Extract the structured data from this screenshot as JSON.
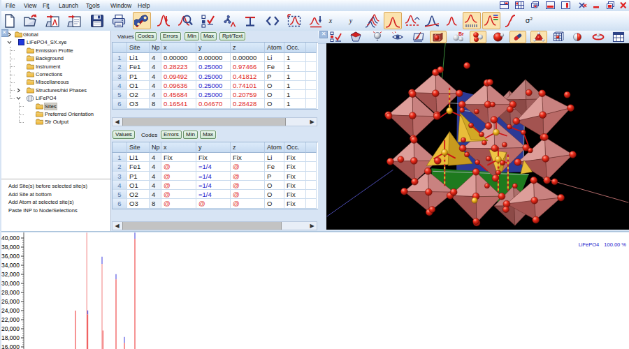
{
  "app": {
    "name": "TOPAS"
  },
  "menu": {
    "items": [
      {
        "label": "File"
      },
      {
        "label": "View"
      },
      {
        "label": "Fit",
        "underline": 2
      },
      {
        "label": "Launch"
      },
      {
        "label": "Tools",
        "underline": 1
      },
      {
        "label": "Window"
      },
      {
        "label": "Help"
      }
    ]
  },
  "window_controls": [
    "tile-panes",
    "arrange-grid",
    "cascade-windows",
    "tile-horizontal",
    "tile-vertical",
    "close-all",
    "minimize",
    "restore",
    "close"
  ],
  "toolbar": {
    "buttons": [
      "new-file",
      "open-file",
      "import-data",
      "open-copy",
      "save",
      "print",
      "fit-wrench",
      "quick-fit",
      "zoom-peak",
      "parameter-list",
      "launch-kernel",
      "tolerance",
      "show-inp-code",
      "select-region",
      "peak-shift",
      "x-axis",
      "y-axis",
      "stack-scans",
      "single-scan",
      "difference-plot",
      "background-plot",
      "calc-pattern",
      "hkl-ticks",
      "legend-display",
      "cumulative-chi2",
      "sigma-squared"
    ],
    "highlighted": [
      "fit-wrench",
      "single-scan",
      "hkl-ticks",
      "legend-display"
    ],
    "x_label": "x",
    "y_label": "y",
    "sigma_label": "σ²"
  },
  "tree": {
    "close_label": "x",
    "items": [
      {
        "label": "Global",
        "depth": 0,
        "icon": "folder",
        "arrow": "collapsed"
      },
      {
        "label": "LiFePO4_SX.xye",
        "depth": 0,
        "icon": "file",
        "arrow": "expanded"
      },
      {
        "label": "Emission Profile",
        "depth": 1,
        "icon": "folder"
      },
      {
        "label": "Background",
        "depth": 1,
        "icon": "folder"
      },
      {
        "label": "Instrument",
        "depth": 1,
        "icon": "folder"
      },
      {
        "label": "Corrections",
        "depth": 1,
        "icon": "folder"
      },
      {
        "label": "Miscellaneous",
        "depth": 1,
        "icon": "folder"
      },
      {
        "label": "Structures/hkl Phases",
        "depth": 1,
        "icon": "folder",
        "arrow": "collapsed"
      },
      {
        "label": "LiFePO4",
        "depth": 1,
        "icon": "phase",
        "arrow": "expanded"
      },
      {
        "label": "Sites",
        "depth": 2,
        "icon": "folder",
        "selected": true
      },
      {
        "label": "Preferred Orientation",
        "depth": 2,
        "icon": "folder"
      },
      {
        "label": "Str Output",
        "depth": 2,
        "icon": "folder"
      }
    ]
  },
  "actions": [
    "Add Site(s) before selected site(s)",
    "Add Site at bottom",
    "Add Atom at selected site(s)",
    "Paste INP to Node/Selections"
  ],
  "tables": [
    {
      "tabs": [
        "Values",
        "Codes",
        "Errors",
        "Min",
        "Max",
        "Rpt/Text"
      ],
      "active_tab": "Values",
      "columns": [
        "",
        "Site",
        "Np",
        "x",
        "y",
        "z",
        "Atom",
        "Occ.",
        ""
      ],
      "rows": [
        [
          "1",
          "Li1",
          "4",
          [
            "0.00000",
            "k"
          ],
          [
            "0.00000",
            "k"
          ],
          [
            "0.00000",
            "k"
          ],
          "Li",
          "1"
        ],
        [
          "2",
          "Fe1",
          "4",
          [
            "0.28223",
            "red"
          ],
          [
            "0.25000",
            "blue"
          ],
          [
            "0.97466",
            "red"
          ],
          "Fe",
          "1"
        ],
        [
          "3",
          "P1",
          "4",
          [
            "0.09492",
            "red"
          ],
          [
            "0.25000",
            "blue"
          ],
          [
            "0.41812",
            "red"
          ],
          "P",
          "1"
        ],
        [
          "4",
          "O1",
          "4",
          [
            "0.09636",
            "red"
          ],
          [
            "0.25000",
            "blue"
          ],
          [
            "0.74101",
            "red"
          ],
          "O",
          "1"
        ],
        [
          "5",
          "O2",
          "4",
          [
            "0.45684",
            "red"
          ],
          [
            "0.25000",
            "blue"
          ],
          [
            "0.20759",
            "red"
          ],
          "O",
          "1"
        ],
        [
          "6",
          "O3",
          "8",
          [
            "0.16541",
            "red"
          ],
          [
            "0.04670",
            "red"
          ],
          [
            "0.28428",
            "red"
          ],
          "O",
          "1"
        ]
      ]
    },
    {
      "tabs": [
        "Values",
        "Codes",
        "Errors",
        "Min",
        "Max"
      ],
      "active_tab": "Codes",
      "columns": [
        "",
        "Site",
        "Np",
        "x",
        "y",
        "z",
        "Atom",
        "Occ.",
        ""
      ],
      "rows": [
        [
          "1",
          "Li1",
          "4",
          [
            "Fix",
            "k"
          ],
          [
            "Fix",
            "k"
          ],
          [
            "Fix",
            "k"
          ],
          "Li",
          "Fix"
        ],
        [
          "2",
          "Fe1",
          "4",
          [
            "@",
            "red"
          ],
          [
            "=1/4",
            "blue"
          ],
          [
            "@",
            "red"
          ],
          "Fe",
          "Fix"
        ],
        [
          "3",
          "P1",
          "4",
          [
            "@",
            "red"
          ],
          [
            "=1/4",
            "blue"
          ],
          [
            "@",
            "red"
          ],
          "P",
          "Fix"
        ],
        [
          "4",
          "O1",
          "4",
          [
            "@",
            "red"
          ],
          [
            "=1/4",
            "blue"
          ],
          [
            "@",
            "red"
          ],
          "O",
          "Fix"
        ],
        [
          "5",
          "O2",
          "4",
          [
            "@",
            "red"
          ],
          [
            "=1/4",
            "blue"
          ],
          [
            "@",
            "red"
          ],
          "O",
          "Fix"
        ],
        [
          "6",
          "O3",
          "8",
          [
            "@",
            "red"
          ],
          [
            "@",
            "red"
          ],
          [
            "@",
            "red"
          ],
          "O",
          "Fix"
        ]
      ]
    }
  ],
  "structure_viewer": {
    "toolbar": [
      "close-pane",
      "site-list",
      "polyhedra-style",
      "balloon-style",
      "view-options",
      "edit-structure",
      "unit-cell-box",
      "element-labels",
      "spheres-display",
      "spacefill-style",
      "stick-style",
      "polyhedra-display",
      "cell-grid",
      "occupancy-display",
      "bond-style",
      "properties-table"
    ],
    "toolbar_highlighted": [
      "unit-cell-box",
      "spheres-display",
      "stick-style",
      "polyhedra-display"
    ],
    "phase": "LiFePO4",
    "colors": {
      "octahedra": "#c98280",
      "tetrahedra": "#e9bd3a",
      "oxygen": "#e02215",
      "phosphorus": "#f0b820",
      "cell_plane_bc": "#2c3a96",
      "cell_plane_ab": "#1e7a1e",
      "axis_a": "#b06868",
      "axis_b": "#3a8a3a",
      "axis_c": "#4a4aa8",
      "background": "#000000"
    }
  },
  "chart_data": {
    "type": "bar",
    "title": "",
    "xlabel": "",
    "ylabel": "",
    "grid": false,
    "legend_position": "top-right",
    "legend": {
      "phase": "LiFePO4",
      "percent": "100.00 %"
    },
    "series": [
      {
        "name": "observed",
        "color": "#4a4ae0"
      },
      {
        "name": "calculated",
        "color": "#ee3b3b"
      },
      {
        "name": "calculated-faint",
        "color": "#f28a8a"
      }
    ],
    "y_axis": {
      "ticks": [
        "40,000",
        "38,000",
        "36,000",
        "34,000",
        "32,000",
        "30,000",
        "28,000",
        "26,000",
        "24,000",
        "22,000",
        "20,000",
        "18,000",
        "16,000"
      ],
      "tick_values": [
        40000,
        38000,
        36000,
        34000,
        32000,
        30000,
        28000,
        26000,
        24000,
        22000,
        20000,
        18000,
        16000
      ],
      "visible_range_top": 41200,
      "visible_range_bottom": 15550
    },
    "sticks": [
      {
        "x": 108,
        "segs": [
          {
            "c": "calculated",
            "v1": 24000,
            "v2": "bottom"
          }
        ]
      },
      {
        "x": 124.2,
        "segs": [
          {
            "c": "calculated-faint",
            "v1": 41200,
            "v2": "bottom"
          }
        ]
      },
      {
        "x": 125.6,
        "segs": [
          {
            "c": "observed",
            "v1": 24050,
            "v2": 23150
          },
          {
            "c": "calculated",
            "v1": 23150,
            "v2": "bottom"
          }
        ]
      },
      {
        "x": 146,
        "segs": [
          {
            "c": "observed",
            "v1": 35900,
            "v2": 34300
          },
          {
            "c": "calculated-faint",
            "v1": 34300,
            "v2": "bottom"
          }
        ]
      },
      {
        "x": 147.3,
        "segs": [
          {
            "c": "calculated",
            "v1": 19600,
            "v2": "bottom"
          }
        ]
      },
      {
        "x": 166,
        "segs": [
          {
            "c": "observed",
            "v1": 32050,
            "v2": 30900
          },
          {
            "c": "calculated",
            "v1": 30900,
            "v2": "bottom"
          }
        ]
      },
      {
        "x": 178,
        "segs": [
          {
            "c": "observed",
            "v1": 18200,
            "v2": 16900
          },
          {
            "c": "calculated",
            "v1": 16900,
            "v2": "bottom"
          }
        ]
      },
      {
        "x": 193,
        "segs": [
          {
            "c": "observed",
            "v1": 41200,
            "v2": 39800
          },
          {
            "c": "calculated",
            "v1": 39800,
            "v2": "bottom"
          }
        ]
      }
    ]
  }
}
